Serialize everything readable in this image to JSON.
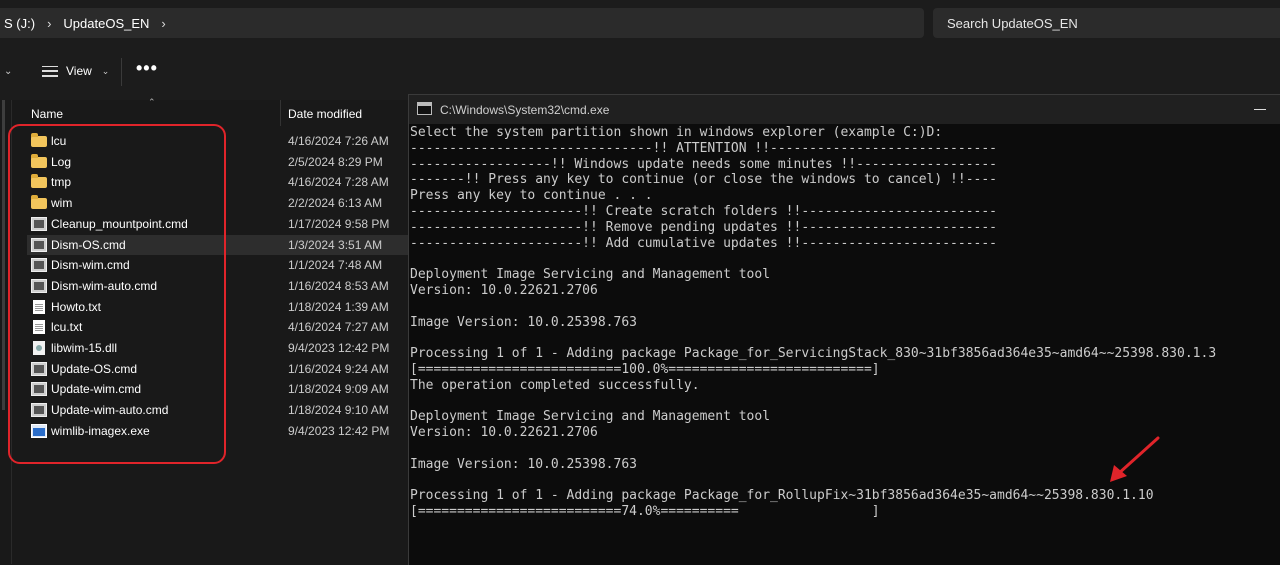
{
  "address": {
    "drive": "S (J:)",
    "folder": "UpdateOS_EN"
  },
  "search": {
    "placeholder": "Search UpdateOS_EN"
  },
  "toolbar": {
    "view_label": "View",
    "more_label": "•••"
  },
  "columns": {
    "name": "Name",
    "date": "Date modified"
  },
  "files": [
    {
      "name": "lcu",
      "date": "4/16/2024 7:26 AM",
      "type": "folder"
    },
    {
      "name": "Log",
      "date": "2/5/2024 8:29 PM",
      "type": "folder"
    },
    {
      "name": "tmp",
      "date": "4/16/2024 7:28 AM",
      "type": "folder"
    },
    {
      "name": "wim",
      "date": "2/2/2024 6:13 AM",
      "type": "folder"
    },
    {
      "name": "Cleanup_mountpoint.cmd",
      "date": "1/17/2024 9:58 PM",
      "type": "cmd"
    },
    {
      "name": "Dism-OS.cmd",
      "date": "1/3/2024 3:51 AM",
      "type": "cmd"
    },
    {
      "name": "Dism-wim.cmd",
      "date": "1/1/2024 7:48 AM",
      "type": "cmd"
    },
    {
      "name": "Dism-wim-auto.cmd",
      "date": "1/16/2024 8:53 AM",
      "type": "cmd"
    },
    {
      "name": "Howto.txt",
      "date": "1/18/2024 1:39 AM",
      "type": "txt"
    },
    {
      "name": "lcu.txt",
      "date": "4/16/2024 7:27 AM",
      "type": "txt"
    },
    {
      "name": "libwim-15.dll",
      "date": "9/4/2023 12:42 PM",
      "type": "dll"
    },
    {
      "name": "Update-OS.cmd",
      "date": "1/16/2024 9:24 AM",
      "type": "cmd"
    },
    {
      "name": "Update-wim.cmd",
      "date": "1/18/2024 9:09 AM",
      "type": "cmd"
    },
    {
      "name": "Update-wim-auto.cmd",
      "date": "1/18/2024 9:10 AM",
      "type": "cmd"
    },
    {
      "name": "wimlib-imagex.exe",
      "date": "9/4/2023 12:42 PM",
      "type": "exe"
    }
  ],
  "cmd": {
    "title": "C:\\Windows\\System32\\cmd.exe",
    "lines": [
      "Select the system partition shown in windows explorer (example C:)D:",
      "-------------------------------!! ATTENTION !!-----------------------------",
      "------------------!! Windows update needs some minutes !!------------------",
      "-------!! Press any key to continue (or close the windows to cancel) !!----",
      "Press any key to continue . . .",
      "----------------------!! Create scratch folders !!-------------------------",
      "----------------------!! Remove pending updates !!-------------------------",
      "----------------------!! Add cumulative updates !!-------------------------",
      "",
      "Deployment Image Servicing and Management tool",
      "Version: 10.0.22621.2706",
      "",
      "Image Version: 10.0.25398.763",
      "",
      "Processing 1 of 1 - Adding package Package_for_ServicingStack_830~31bf3856ad364e35~amd64~~25398.830.1.3",
      "[==========================100.0%==========================]",
      "The operation completed successfully.",
      "",
      "Deployment Image Servicing and Management tool",
      "Version: 10.0.22621.2706",
      "",
      "Image Version: 10.0.25398.763",
      "",
      "Processing 1 of 1 - Adding package Package_for_RollupFix~31bf3856ad364e35~amd64~~25398.830.1.10",
      "[==========================74.0%==========                 ]"
    ]
  },
  "colors": {
    "highlight": "#e0242a",
    "folder": "#f2c55c",
    "console_bg": "#0c0c0c"
  }
}
